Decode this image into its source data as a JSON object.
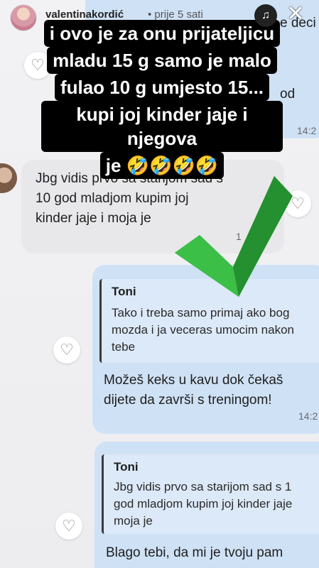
{
  "header": {
    "username": "valentinakordić",
    "timeago": "• prije 5 sati",
    "music_icon": "music-note-icon",
    "close_icon": "close-icon"
  },
  "caption": {
    "lines": [
      "i ovo je za onu prijateljicu",
      "mladu 15 g samo je malo",
      "fulao 10 g umjesto 15...",
      "kupi joj kinder jaje i njegova",
      "je 🤣🤣🤣🤣"
    ]
  },
  "messages": {
    "top_partial": {
      "text_a": "e deci",
      "text_b": "od",
      "time": "14:2"
    },
    "incoming": {
      "text": [
        "Jbg vidis prvo sa starijom sad s",
        "10 god mladjom kupim joj",
        "kinder jaje i moja je"
      ],
      "time": "1"
    },
    "reply1": {
      "quote_author": "Toni",
      "quote_text": [
        "Tako i treba samo primaj ako bog",
        "mozda i ja veceras umocim nakon",
        "tebe"
      ],
      "text": [
        "Možeš keks u kavu dok čekaš",
        "dijete da završi s treningom!"
      ],
      "time": "14:2"
    },
    "reply2": {
      "quote_author": "Toni",
      "quote_text": [
        "Jbg vidis prvo sa starijom sad s 1",
        "god mladjom kupim joj kinder jaje",
        "moja je"
      ],
      "text": [
        "Blago tebi, da mi je tvoju pam"
      ]
    }
  },
  "icons": {
    "heart": "heart-outline-icon",
    "check": "green-checkmark-sticker"
  },
  "colors": {
    "outgoing_bubble": "#cfe1f5",
    "incoming_bubble": "#e8e8ea",
    "check_green": "#2fa33a"
  }
}
